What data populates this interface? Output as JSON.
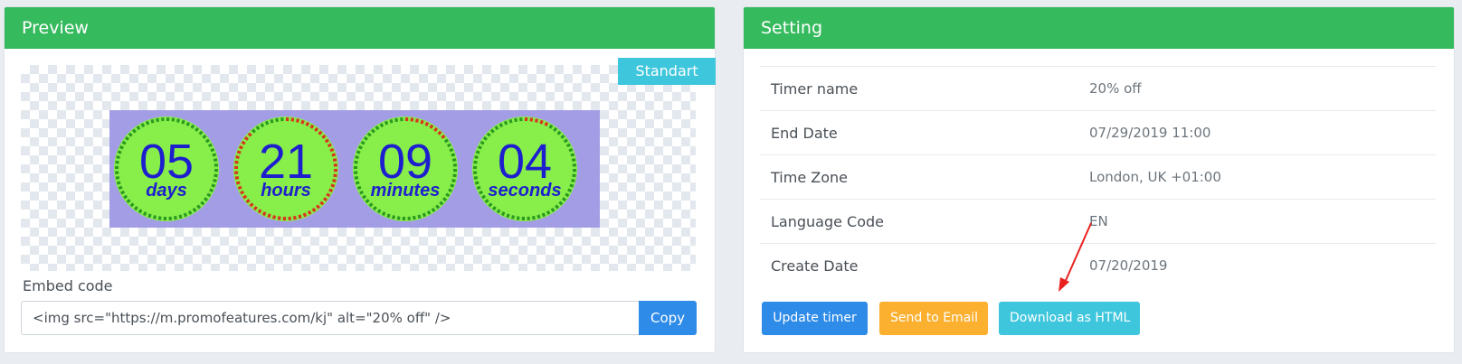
{
  "preview": {
    "title": "Preview",
    "badge": "Standart",
    "timer": {
      "background": "#a39de6",
      "circle_fill": "#88ee4a",
      "number_color": "#1d1fce",
      "dash_green": "#2a9a1f",
      "dash_red": "#d6361e",
      "units": [
        {
          "value": "05",
          "label": "days",
          "red_fraction": 0.0
        },
        {
          "value": "21",
          "label": "hours",
          "red_fraction": 0.88
        },
        {
          "value": "09",
          "label": "minutes",
          "red_fraction": 0.15
        },
        {
          "value": "04",
          "label": "seconds",
          "red_fraction": 0.07
        }
      ]
    },
    "embed_label": "Embed code",
    "embed_value": "<img src=\"https://m.promofeatures.com/kj\" alt=\"20% off\" />",
    "copy_label": "Copy"
  },
  "setting": {
    "title": "Setting",
    "rows": [
      {
        "key": "Timer name",
        "value": "20% off"
      },
      {
        "key": "End Date",
        "value": "07/29/2019 11:00"
      },
      {
        "key": "Time Zone",
        "value": "London, UK +01:00"
      },
      {
        "key": "Language Code",
        "value": "EN"
      },
      {
        "key": "Create Date",
        "value": "07/20/2019"
      }
    ],
    "buttons": {
      "update": "Update timer",
      "email": "Send to Email",
      "html": "Download as HTML"
    }
  },
  "colors": {
    "header": "#35ba5d",
    "primary": "#2e8be8",
    "warning": "#fbb030",
    "info": "#3ec6dc"
  }
}
